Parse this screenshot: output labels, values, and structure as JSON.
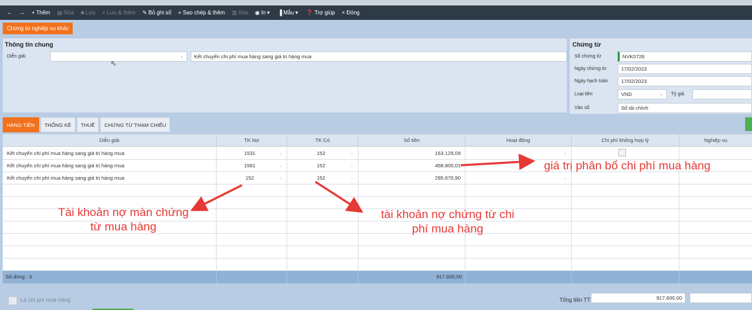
{
  "toolbar": {
    "back": "←",
    "forward": "→",
    "add": "+ Thêm",
    "edit": "Sửa",
    "save": "Lưu",
    "save_add": "+ Lưu & thêm",
    "unpost": "Bỏ ghi sổ",
    "copy_add": "+ Sao chép & thêm",
    "delete": "Xóa",
    "print": "In",
    "template": "Mẫu",
    "help": "Trợ giúp",
    "close": "× Đóng"
  },
  "other_voucher_button": "Chứng từ nghiệp vụ khác",
  "general": {
    "title": "Thông tin chung",
    "description_label": "Diễn giải",
    "description_value": "Kết chuyển chi phí mua hàng sang giá trị hàng mua"
  },
  "voucher": {
    "title": "Chứng từ",
    "number_label": "Số chứng từ",
    "number_value": "NVK0728",
    "date_label": "Ngày chứng từ",
    "date_value": "17/02/2023",
    "posting_label": "Ngày hạch toán",
    "posting_value": "17/02/2023",
    "currency_label": "Loại tiền",
    "currency_value": "VND",
    "rate_label": "Tỷ giá",
    "book_label": "Vào sổ",
    "book_value": "Sổ tài chính"
  },
  "tabs": [
    "HÀNG TIỀN",
    "THỐNG KÊ",
    "THUẾ",
    "CHỨNG TỪ THAM CHIẾU"
  ],
  "grid": {
    "columns": [
      "Diễn giải",
      "TK Nợ",
      "TK Có",
      "Số tiền",
      "Hoạt động",
      "Chi phí không hợp lý",
      "Nghiệp vụ"
    ],
    "rows": [
      [
        "Kết chuyển chi phí mua hàng sang giá trị hàng mua",
        "1531",
        "152",
        "163.129,09"
      ],
      [
        "Kết chuyển chi phí mua hàng sang giá trị hàng mua",
        "1561",
        "152",
        "458.800,01"
      ],
      [
        "Kết chuyển chi phí mua hàng sang giá trị hàng mua",
        "152",
        "152",
        "295.670,90"
      ]
    ],
    "footer_count": "Số dòng : 3",
    "footer_total": "917.600,00"
  },
  "bottom": {
    "purchase_cost_label": "Là chi phí mua hàng",
    "total_label": "Tổng tiền TT",
    "total_value": "917.600,00"
  },
  "annotations": {
    "allocated_value": "giá trị phân bổ chi phí mua hàng",
    "debit_purchase": "Tài khoản nợ màn chứng từ mua hàng",
    "debit_cost": "tài khoản nợ chứng từ chi phí mua hàng"
  },
  "colors": {
    "accent": "#f2711c",
    "toolbar": "#2f3a47",
    "annotation": "#e53935"
  }
}
